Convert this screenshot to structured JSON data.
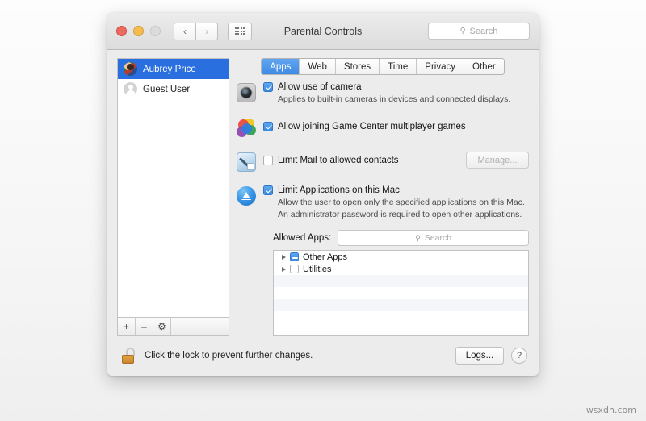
{
  "window": {
    "title": "Parental Controls",
    "traffic_lights": [
      "close",
      "minimize",
      "zoom"
    ],
    "nav": {
      "back": "‹",
      "forward": "›"
    },
    "grid_button": "all-preferences-icon",
    "search": {
      "placeholder": "Search",
      "icon": "search-icon",
      "value": ""
    }
  },
  "sidebar": {
    "users": [
      {
        "name": "Aubrey Price",
        "selected": true,
        "avatar": "user-photo"
      },
      {
        "name": "Guest User",
        "selected": false,
        "avatar": "guest-silhouette"
      }
    ],
    "footer": {
      "add": "+",
      "remove": "–",
      "gear": "⚙"
    }
  },
  "tabs": [
    {
      "label": "Apps",
      "active": true
    },
    {
      "label": "Web",
      "active": false
    },
    {
      "label": "Stores",
      "active": false
    },
    {
      "label": "Time",
      "active": false
    },
    {
      "label": "Privacy",
      "active": false
    },
    {
      "label": "Other",
      "active": false
    }
  ],
  "settings": {
    "camera": {
      "icon": "camera-icon",
      "label": "Allow use of camera",
      "checked": true,
      "description": "Applies to built-in cameras in devices and connected displays."
    },
    "game_center": {
      "icon": "game-center-icon",
      "label": "Allow joining Game Center multiplayer games",
      "checked": true
    },
    "mail": {
      "icon": "mail-icon",
      "label": "Limit Mail to allowed contacts",
      "checked": false,
      "manage_label": "Manage...",
      "manage_enabled": false
    },
    "limit_apps": {
      "icon": "app-store-icon",
      "label": "Limit Applications on this Mac",
      "checked": true,
      "description": "Allow the user to open only the specified applications on this Mac. An administrator password is required to open other applications."
    }
  },
  "allowed_apps": {
    "label": "Allowed Apps:",
    "search": {
      "placeholder": "Search",
      "icon": "search-icon",
      "value": ""
    },
    "rows": [
      {
        "name": "Other Apps",
        "state": "mixed"
      },
      {
        "name": "Utilities",
        "state": "off"
      }
    ]
  },
  "footer": {
    "lock_icon": "unlocked-padlock-icon",
    "message": "Click the lock to prevent further changes.",
    "logs_label": "Logs...",
    "help_label": "?"
  },
  "watermark": "wsxdn.com",
  "colors": {
    "accent": "#3a8ae3",
    "selection": "#2a6fe0",
    "window_bg": "#ececec",
    "lock_gold": "#d8942f"
  }
}
